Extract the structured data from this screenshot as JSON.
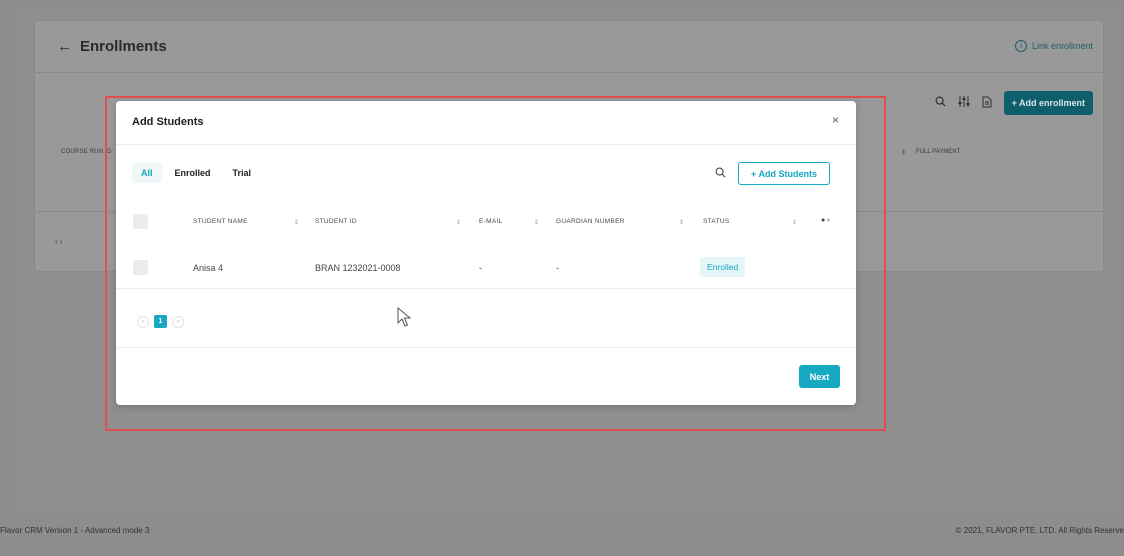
{
  "background": {
    "back_arrow": "←",
    "page_title": "Enrollments",
    "link_enrollment": "Link enrollment",
    "add_enrollment": "+ Add enrollment",
    "col_course_run": "COURSE RUN ID",
    "col_full_payment": "FULL PAYMENT",
    "footer_left": "Flavor CRM Version 1 - Advanced mode 3",
    "footer_right": "© 2021, FLAVOR PTE. LTD. All Rights Reserve"
  },
  "modal": {
    "title": "Add Students",
    "close_label": "×",
    "tabs": [
      {
        "label": "All",
        "active": true
      },
      {
        "label": "Enrolled",
        "active": false
      },
      {
        "label": "Trial",
        "active": false
      }
    ],
    "add_students_label": "+ Add Students",
    "columns": [
      "STUDENT NAME",
      "STUDENT ID",
      "E-MAIL",
      "GUARDIAN NUMBER",
      "STATUS"
    ],
    "rows": [
      {
        "name": "Anisa 4",
        "student_id": "BRAN 1232021-0008",
        "email": "-",
        "guardian": "-",
        "status": "Enrolled"
      }
    ],
    "pagination": {
      "current_page": "1"
    },
    "next_label": "Next"
  },
  "colors": {
    "accent": "#18a9c2",
    "highlight": "#e34d4d",
    "overlay": "#8d8d8d"
  },
  "icons": [
    "back-arrow-icon",
    "info-icon",
    "search-icon",
    "filter-icon",
    "export-icon",
    "close-icon",
    "sort-icon",
    "more-icon",
    "chevron-left-icon",
    "chevron-right-icon",
    "mouse-cursor-icon"
  ]
}
